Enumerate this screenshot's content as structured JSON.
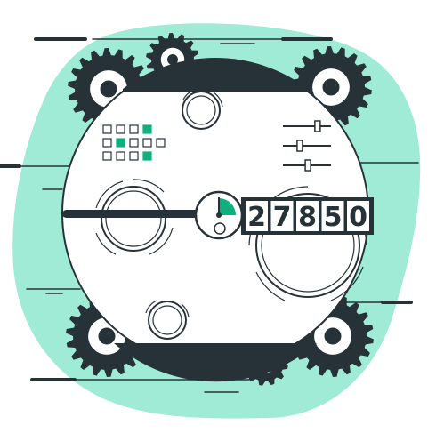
{
  "colors": {
    "accent": "#10B07E",
    "accent_light": "#9FEBD6",
    "dark": "#263238",
    "panel": "#ffffff"
  },
  "counter": {
    "digits": [
      "2",
      "7",
      "8",
      "5",
      "0"
    ]
  },
  "gauge": {
    "fill_fraction": 0.25
  },
  "led_grid": {
    "rows": [
      [
        false,
        false,
        false,
        true,
        false
      ],
      [
        false,
        true,
        false,
        false,
        false
      ],
      [
        false,
        false,
        false,
        true,
        false
      ]
    ],
    "row_lengths": [
      4,
      5,
      4
    ]
  },
  "sliders": {
    "levels": [
      0.72,
      0.35,
      0.52
    ]
  },
  "icons": [
    "gear-icon",
    "gauge-icon",
    "slider-icon",
    "led-indicator-icon"
  ]
}
